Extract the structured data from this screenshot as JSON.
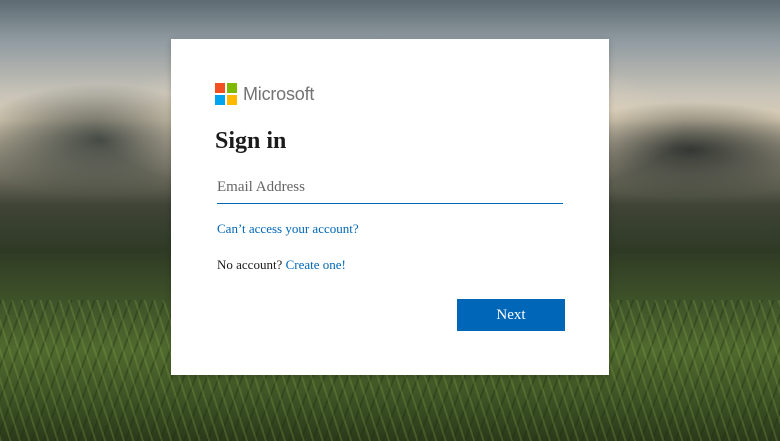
{
  "logo": {
    "text": "Microsoft",
    "colors": [
      "#f25022",
      "#7fba00",
      "#00a4ef",
      "#ffb900"
    ]
  },
  "signin": {
    "title": "Sign in",
    "email_placeholder": "Email Address",
    "email_value": "",
    "cant_access_label": "Can’t access your account?",
    "no_account_text": "No account?",
    "create_label": "Create one!",
    "next_label": "Next"
  },
  "colors": {
    "accent": "#0067b8",
    "logo_text": "#737373",
    "title": "#1b1b1b"
  }
}
